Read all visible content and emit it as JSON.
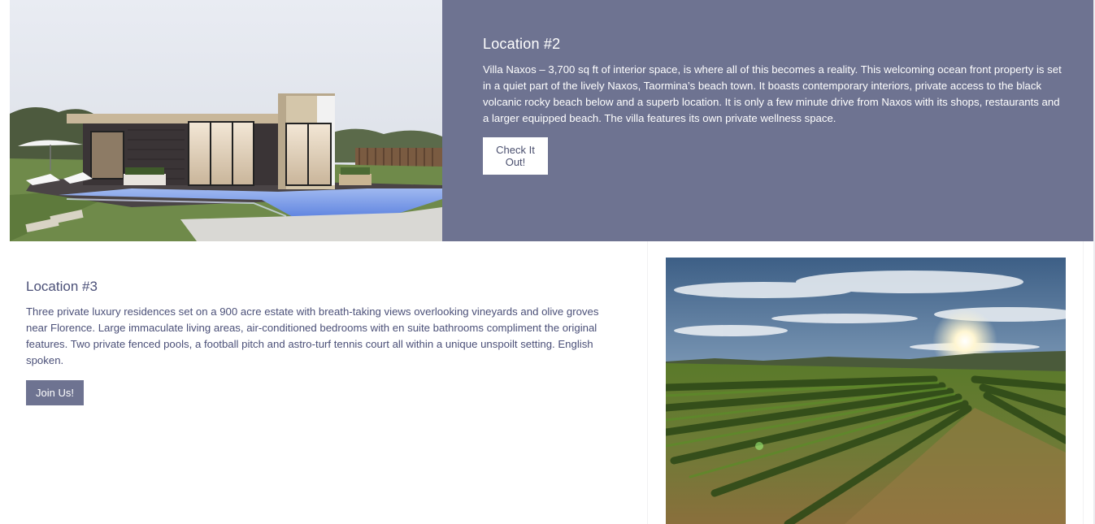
{
  "location2": {
    "title": "Location #2",
    "description": "Villa Naxos – 3,700 sq ft of interior space, is where all of this becomes a reality. This welcoming ocean front property is set in a quiet part of the lively Naxos, Taormina’s beach town. It boasts contemporary interiors, private access to the black volcanic rocky beach below and a superb location. It is only a few minute drive from Naxos with its shops, restaurants and a larger equipped beach. The villa features its own private wellness space.",
    "button_label": "Check It Out!",
    "image_icon": "modern-villa-with-pool-photo"
  },
  "location3": {
    "title": "Location #3",
    "description": "Three private luxury residences set on a 900 acre estate with breath-taking views overlooking vineyards and olive groves near Florence. Large immaculate living areas, air-conditioned bedrooms with en suite bathrooms compliment the original features. Two private fenced pools, a football pitch and astro-turf tennis court all within a unique unspoilt setting. English spoken.",
    "button_label": "Join Us!",
    "image_icon": "vineyard-sunset-photo"
  },
  "colors": {
    "accent": "#6e7391",
    "text_dark": "#4b5078",
    "white": "#ffffff"
  }
}
